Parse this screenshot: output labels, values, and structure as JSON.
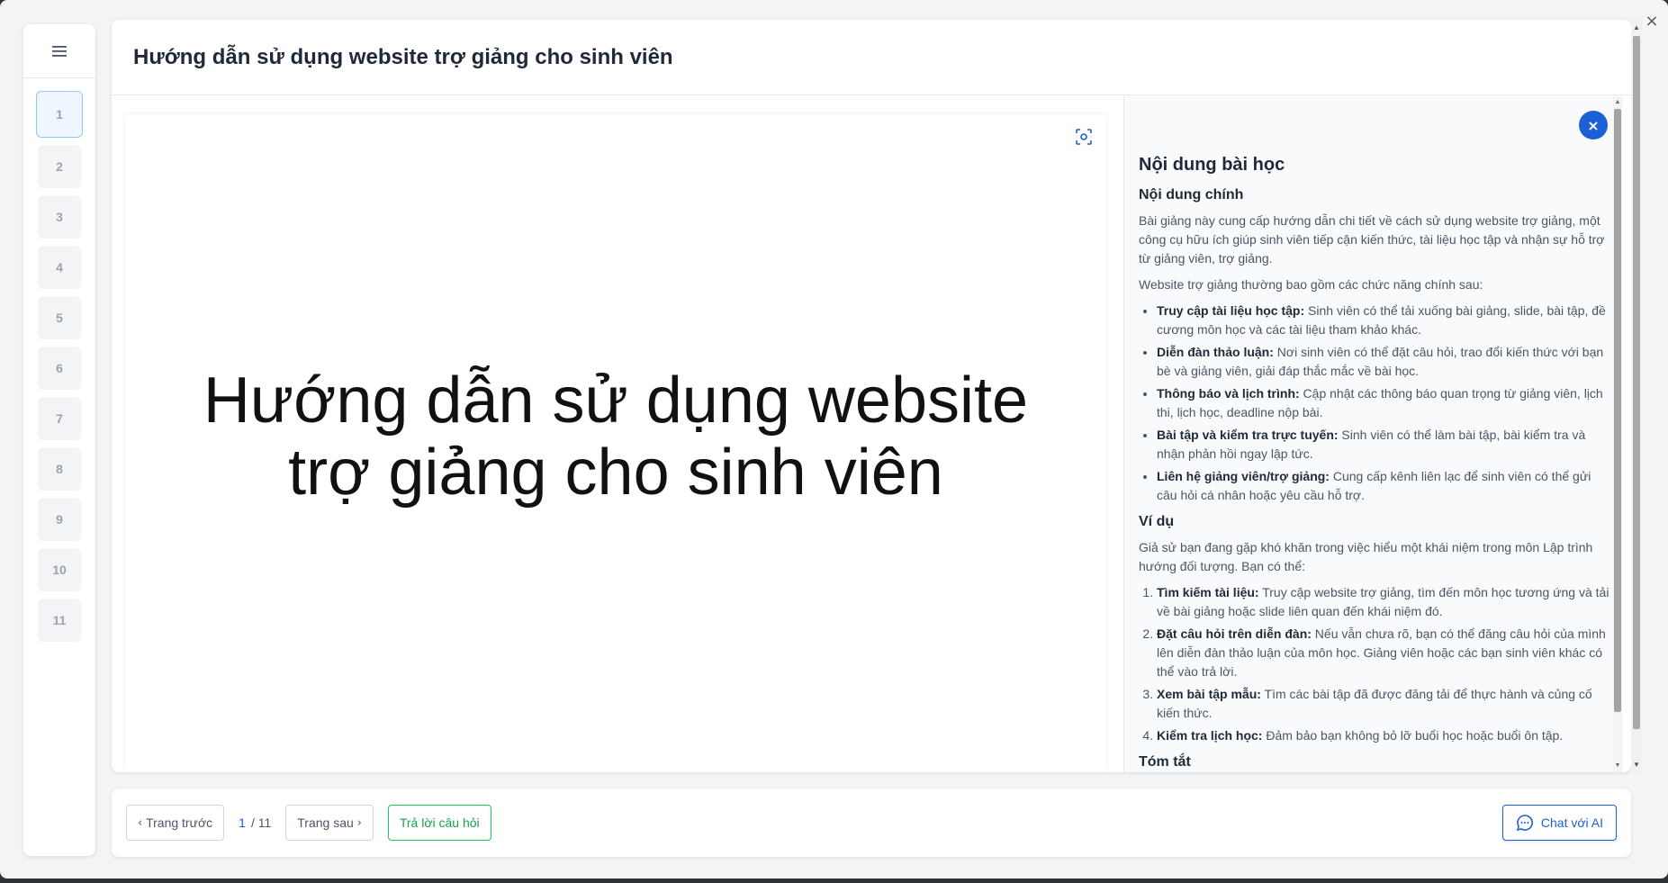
{
  "window": {
    "close_glyph": "×"
  },
  "sidebar": {
    "menu_icon": "hamburger-icon",
    "slides": [
      "1",
      "2",
      "3",
      "4",
      "5",
      "6",
      "7",
      "8",
      "9",
      "10",
      "11"
    ],
    "active_index": 0
  },
  "header": {
    "title": "Hướng dẫn sử dụng website trợ giảng cho sinh viên"
  },
  "slide": {
    "line1": "Hướng dẫn sử dụng website",
    "line2": "trợ giảng cho sinh viên",
    "fit_icon": "focus-screen-icon"
  },
  "panel": {
    "close_glyph": "×",
    "heading": "Nội dung bài học",
    "main_heading": "Nội dung chính",
    "intro": "Bài giảng này cung cấp hướng dẫn chi tiết về cách sử dụng website trợ giảng, một công cụ hữu ích giúp sinh viên tiếp cận kiến thức, tài liệu học tập và nhận sự hỗ trợ từ giảng viên, trợ giảng.",
    "functions_intro": "Website trợ giảng thường bao gồm các chức năng chính sau:",
    "functions": [
      {
        "term": "Truy cập tài liệu học tập:",
        "desc": " Sinh viên có thể tải xuống bài giảng, slide, bài tập, đề cương môn học và các tài liệu tham khảo khác."
      },
      {
        "term": "Diễn đàn thảo luận:",
        "desc": " Nơi sinh viên có thể đặt câu hỏi, trao đổi kiến thức với bạn bè và giảng viên, giải đáp thắc mắc về bài học."
      },
      {
        "term": "Thông báo và lịch trình:",
        "desc": " Cập nhật các thông báo quan trọng từ giảng viên, lịch thi, lịch học, deadline nộp bài."
      },
      {
        "term": "Bài tập và kiểm tra trực tuyến:",
        "desc": " Sinh viên có thể làm bài tập, bài kiểm tra và nhận phản hồi ngay lập tức."
      },
      {
        "term": "Liên hệ giảng viên/trợ giảng:",
        "desc": " Cung cấp kênh liên lạc để sinh viên có thể gửi câu hỏi cá nhân hoặc yêu cầu hỗ trợ."
      }
    ],
    "example_heading": "Ví dụ",
    "example_intro": "Giả sử bạn đang gặp khó khăn trong việc hiểu một khái niệm trong môn Lập trình hướng đối tượng. Bạn có thể:",
    "steps": [
      {
        "term": "Tìm kiếm tài liệu:",
        "desc": " Truy cập website trợ giảng, tìm đến môn học tương ứng và tải về bài giảng hoặc slide liên quan đến khái niệm đó."
      },
      {
        "term": "Đặt câu hỏi trên diễn đàn:",
        "desc": " Nếu vẫn chưa rõ, bạn có thể đăng câu hỏi của mình lên diễn đàn thảo luận của môn học. Giảng viên hoặc các bạn sinh viên khác có thể vào trả lời."
      },
      {
        "term": "Xem bài tập mẫu:",
        "desc": " Tìm các bài tập đã được đăng tải để thực hành và củng cố kiến thức."
      },
      {
        "term": "Kiểm tra lịch học:",
        "desc": " Đảm bảo bạn không bỏ lỡ buổi học hoặc buổi ôn tập."
      }
    ],
    "summary_heading": "Tóm tắt"
  },
  "footer": {
    "prev_label": "Trang trước",
    "current_page": "1",
    "total_pages": "/ 11",
    "next_label": "Trang sau",
    "answer_label": "Trả lời câu hỏi",
    "chat_label": "Chat với AI"
  },
  "colors": {
    "accent": "#1d5fd6",
    "green": "#22c55e"
  }
}
